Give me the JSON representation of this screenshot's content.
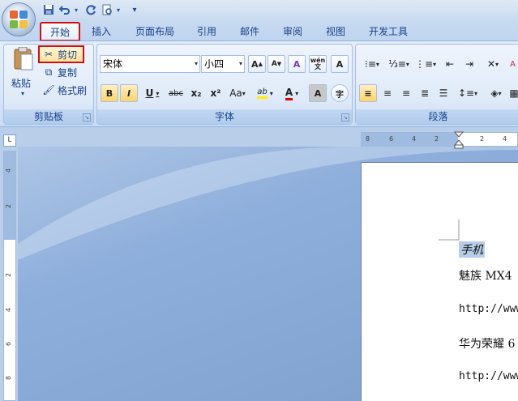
{
  "quick_access": {
    "save_icon": "save-icon",
    "undo_icon": "undo-icon",
    "redo_icon": "redo-icon",
    "preview_icon": "print-preview-icon",
    "customize_glyph": "▾"
  },
  "tabs": [
    {
      "id": "home",
      "label": "开始"
    },
    {
      "id": "insert",
      "label": "插入"
    },
    {
      "id": "layout",
      "label": "页面布局"
    },
    {
      "id": "references",
      "label": "引用"
    },
    {
      "id": "mailings",
      "label": "邮件"
    },
    {
      "id": "review",
      "label": "审阅"
    },
    {
      "id": "view",
      "label": "视图"
    },
    {
      "id": "developer",
      "label": "开发工具"
    }
  ],
  "clipboard": {
    "group_label": "剪贴板",
    "paste_label": "粘贴",
    "cut_label": "剪切",
    "copy_label": "复制",
    "format_painter_label": "格式刷"
  },
  "font": {
    "group_label": "字体",
    "font_name": "宋体",
    "font_size": "小四",
    "grow_label": "A",
    "shrink_label": "A",
    "clear_label": "A",
    "pinyin_label": "wén",
    "border_label": "A",
    "bold": "B",
    "italic": "I",
    "underline": "U",
    "strike": "abc",
    "subscript": "x₂",
    "superscript": "x²",
    "case": "Aa",
    "highlight": "ab",
    "fontcolor": "A",
    "shade": "A",
    "circle": "字"
  },
  "paragraph": {
    "group_label": "段落"
  },
  "hruler_ticks": [
    "8",
    "6",
    "4",
    "2",
    "2",
    "4"
  ],
  "vruler_ticks": [
    "4",
    "2",
    "2",
    "4",
    "6",
    "8"
  ],
  "document": {
    "line1": "手机",
    "line2": "魅族 MX4",
    "line3": "http://www",
    "line4": "华为荣耀 6",
    "line5": "http://www"
  },
  "colors": {
    "accent_red": "#d01010",
    "ribbon_blue": "#dbe8f8",
    "highlight": "#b5cde9"
  }
}
